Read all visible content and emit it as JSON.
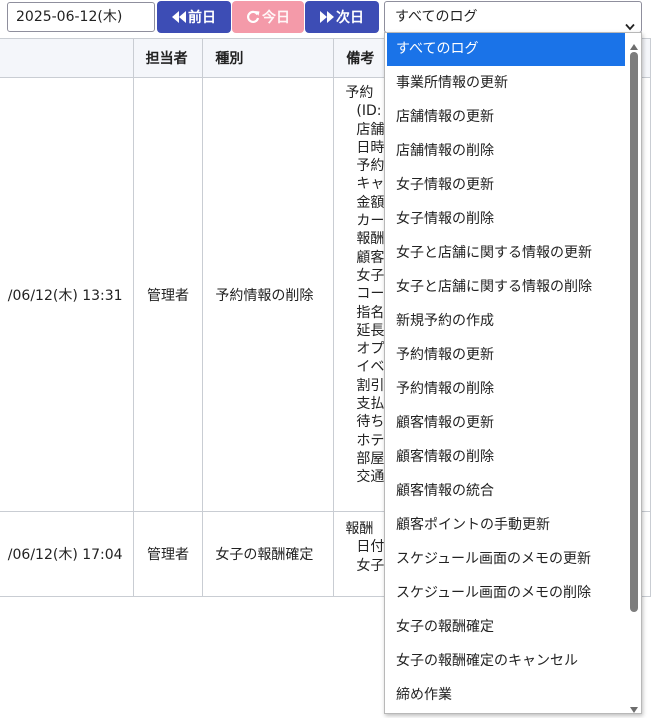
{
  "toolbar": {
    "date_value": "2025-06-12(木)",
    "prev_label": "前日",
    "today_label": "今日",
    "next_label": "次日",
    "log_filter_selected": "すべてのログ"
  },
  "colors": {
    "nav_button": "#3d4db5",
    "today_button": "#f49aa9",
    "selected_option": "#1a73e8"
  },
  "table": {
    "headers": [
      "",
      "担当者",
      "種別",
      "備考"
    ],
    "rows": [
      {
        "datetime": "/06/12(木) 13:31",
        "user": "管理者",
        "type": "予約情報の削除",
        "note_lines": [
          "予約",
          "(ID:",
          "店舗",
          "日時",
          "予約",
          "キャ",
          "金額",
          "カー",
          "報酬",
          "顧客",
          "女子",
          "コー",
          "指名",
          "延長",
          "オプ",
          "イベ",
          "割引",
          "支払",
          "待ち",
          "ホテ",
          "部屋",
          "交通"
        ]
      },
      {
        "datetime": "/06/12(木) 17:04",
        "user": "管理者",
        "type": "女子の報酬確定",
        "note_lines": [
          "報酬",
          "日付",
          "女子"
        ]
      }
    ]
  },
  "dropdown": {
    "options": [
      "すべてのログ",
      "事業所情報の更新",
      "店舗情報の更新",
      "店舗情報の削除",
      "女子情報の更新",
      "女子情報の削除",
      "女子と店舗に関する情報の更新",
      "女子と店舗に関する情報の削除",
      "新規予約の作成",
      "予約情報の更新",
      "予約情報の削除",
      "顧客情報の更新",
      "顧客情報の削除",
      "顧客情報の統合",
      "顧客ポイントの手動更新",
      "スケジュール画面のメモの更新",
      "スケジュール画面のメモの削除",
      "女子の報酬確定",
      "女子の報酬確定のキャンセル",
      "締め作業"
    ],
    "selected_index": 0
  }
}
